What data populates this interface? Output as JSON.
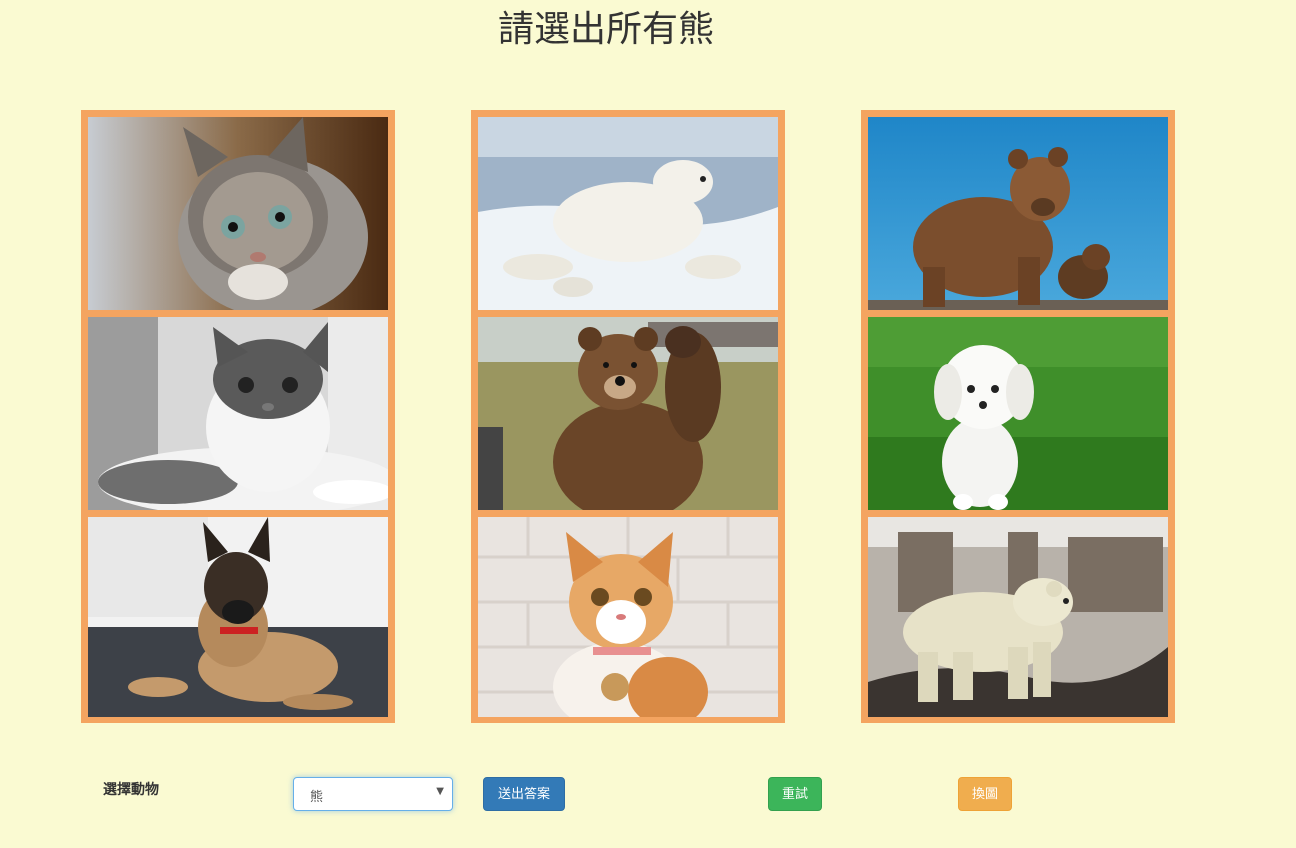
{
  "title": "請選出所有熊",
  "tiles": [
    {
      "icon": "kitten-photo-icon"
    },
    {
      "icon": "polar-bear-jumping-photo-icon"
    },
    {
      "icon": "brown-bear-with-cub-photo-icon"
    },
    {
      "icon": "black-white-cat-photo-icon"
    },
    {
      "icon": "brown-bear-waving-photo-icon"
    },
    {
      "icon": "white-maltese-dog-photo-icon"
    },
    {
      "icon": "shepherd-dog-photo-icon"
    },
    {
      "icon": "orange-cat-photo-icon"
    },
    {
      "icon": "polar-bear-standing-photo-icon"
    }
  ],
  "controls": {
    "choose_label": "選擇動物",
    "select_value": "熊",
    "submit_label": "送出答案",
    "retry_label": "重試",
    "change_label": "換圖"
  },
  "colors": {
    "background": "#fafad2",
    "tile_border": "#f4a460",
    "submit": "#337ab7",
    "retry": "#3cb55a",
    "change": "#f0ad4e"
  }
}
